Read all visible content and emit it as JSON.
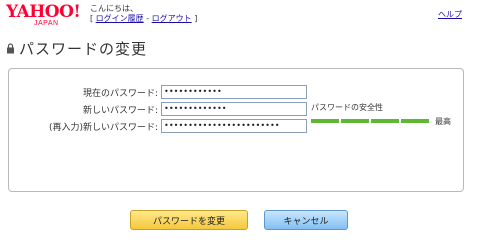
{
  "header": {
    "logo": "YAHOO!",
    "logo_sub": "JAPAN",
    "greeting": "こんにちは、",
    "open_bracket": "[",
    "login_history": "ログイン履歴",
    "separator": "-",
    "logout": "ログアウト",
    "close_bracket": "]",
    "help": "ヘルプ"
  },
  "page": {
    "title": "パスワードの変更"
  },
  "form": {
    "current_label": "現在のパスワード:",
    "current_value": "••••••••••••",
    "new_label": "新しいパスワード:",
    "new_value": "•••••••••••••",
    "confirm_label": "(再入力)新しいパスワード:",
    "confirm_value": "••••••••••••••••••••••••"
  },
  "strength": {
    "label": "パスワードの安全性",
    "level_text": "最高",
    "segments_filled": 5,
    "segments_total": 5,
    "color": "#5fb832"
  },
  "buttons": {
    "change": "パスワードを変更",
    "cancel": "キャンセル"
  }
}
